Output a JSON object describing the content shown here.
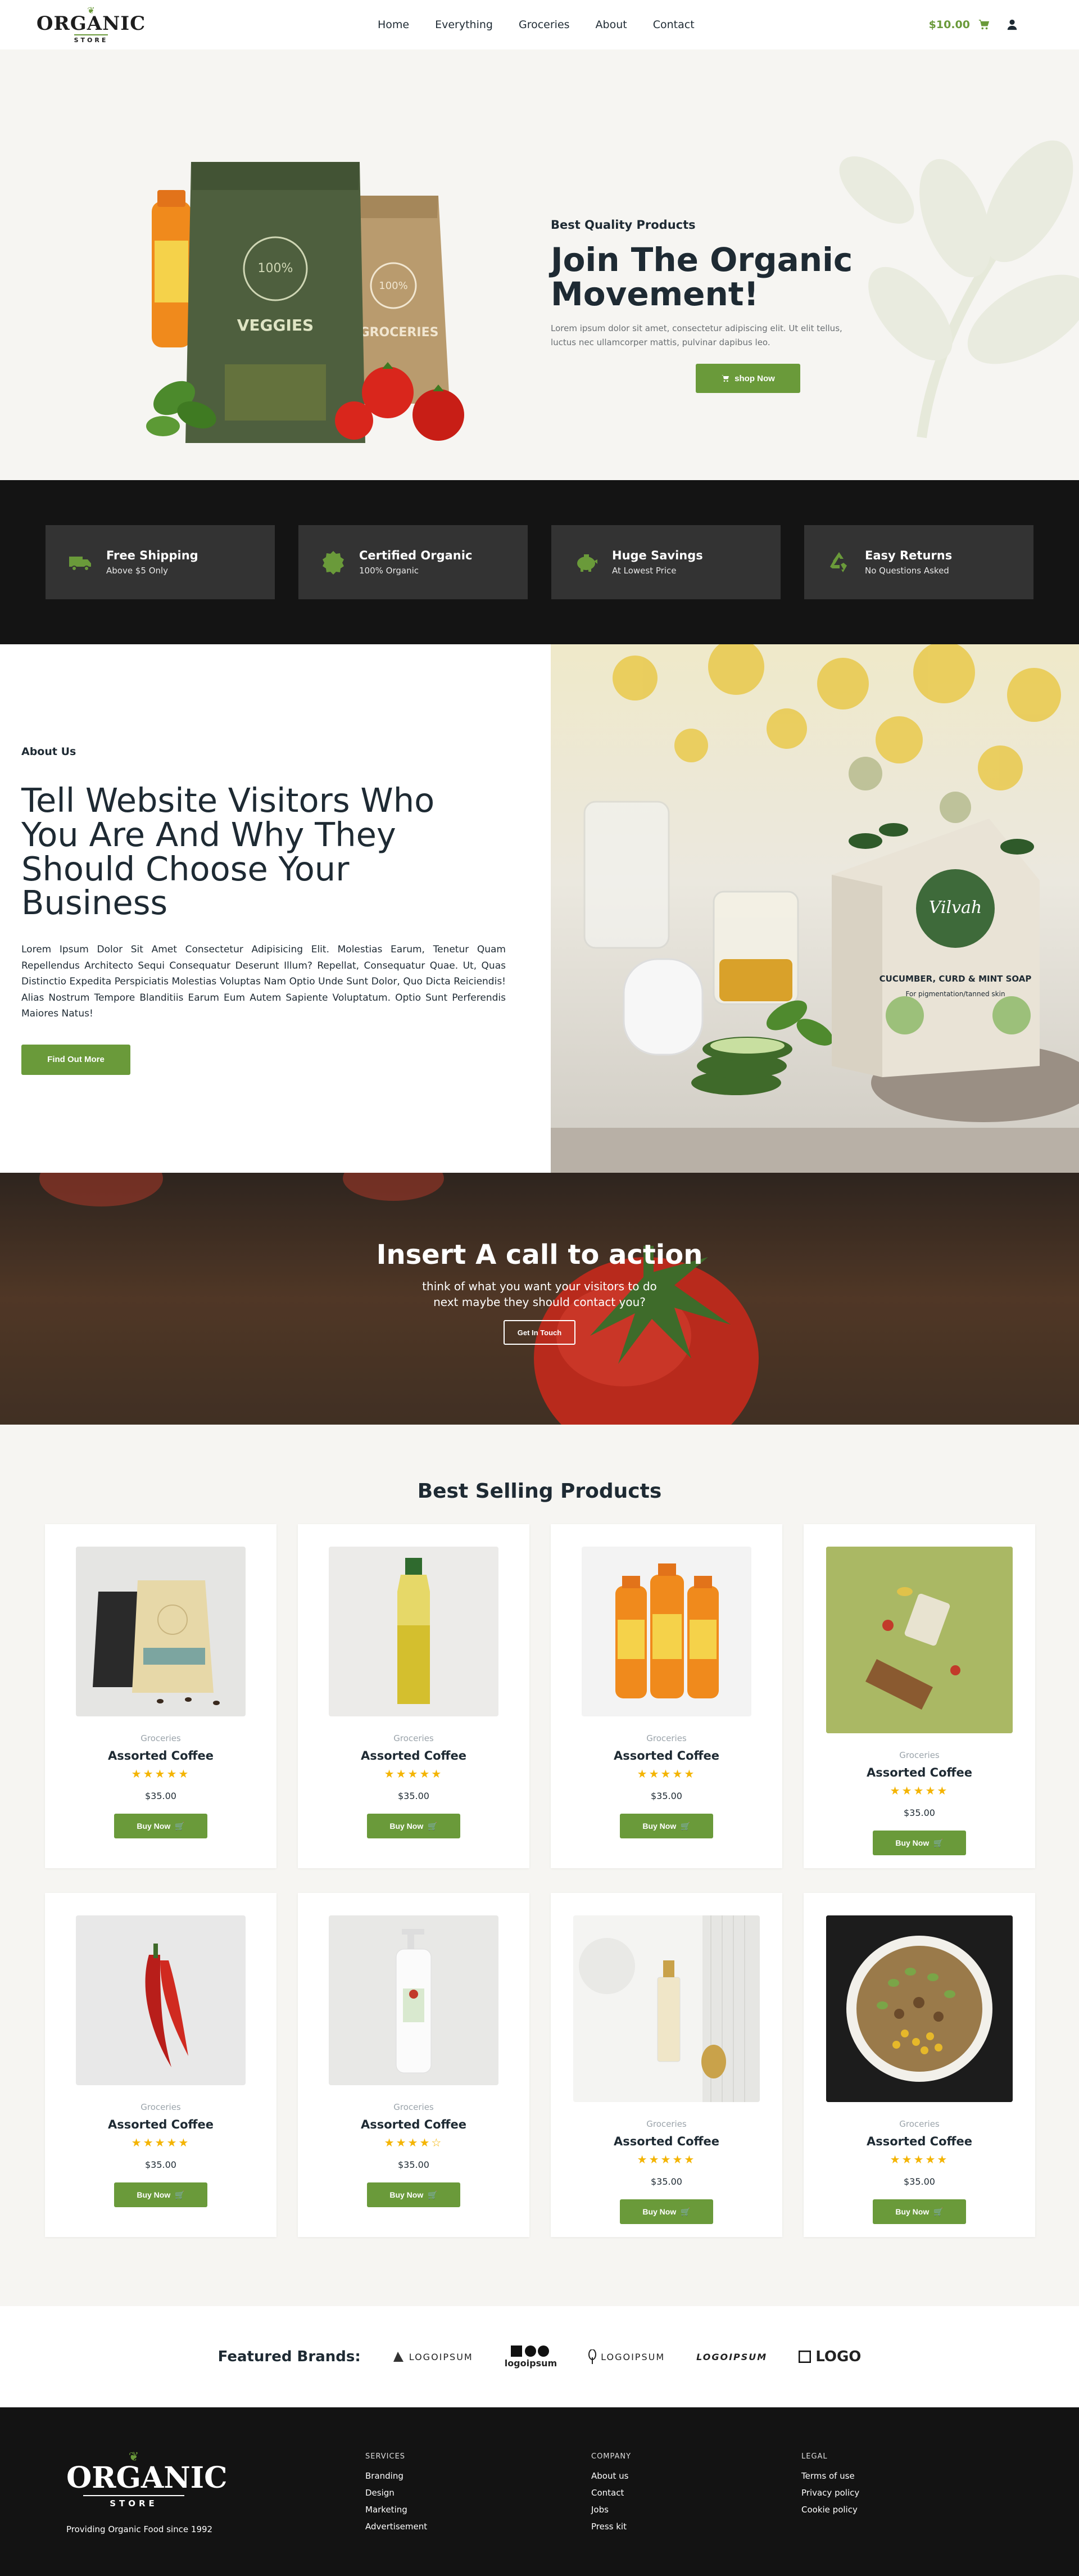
{
  "logo": {
    "top": "ORGANIC",
    "bottom": "STORE"
  },
  "nav": {
    "items": [
      "Home",
      "Everything",
      "Groceries",
      "About",
      "Contact"
    ],
    "cart_total": "$10.00"
  },
  "hero": {
    "subtitle": "Best Quality Products",
    "title": "Join The Organic Movement!",
    "description": "Lorem ipsum dolor sit amet, consectetur adipiscing elit. Ut elit tellus, luctus nec ullamcorper mattis, pulvinar dapibus leo.",
    "button": "shop Now",
    "bag1_label": "VEGGIES",
    "bag2_label": "GROCERIES",
    "badge": "100%"
  },
  "features": [
    {
      "title": "Free Shipping",
      "subtitle": "Above $5 Only",
      "icon": "truck-icon"
    },
    {
      "title": "Certified Organic",
      "subtitle": "100% Organic",
      "icon": "badge-icon"
    },
    {
      "title": "Huge Savings",
      "subtitle": "At Lowest Price",
      "icon": "piggy-bank-icon"
    },
    {
      "title": "Easy Returns",
      "subtitle": "No Questions Asked",
      "icon": "recycle-icon"
    }
  ],
  "about": {
    "tag": "About Us",
    "title": "Tell Website Visitors Who You Are And Why They Should Choose Your Business",
    "text": "Lorem Ipsum Dolor Sit Amet Consectetur Adipisicing Elit. Molestias Earum, Tenetur Quam Repellendus Architecto Sequi Consequatur Deserunt Illum? Repellat, Consequatur Quae. Ut, Quas Distinctio Expedita Perspiciatis Molestias Voluptas Nam Optio Unde Sunt Dolor, Quo Dicta Reiciendis! Alias Nostrum Tempore Blanditiis Earum Eum Autem Sapiente Voluptatum. Optio Sunt Perferendis Maiores Natus!",
    "button": "Find Out More",
    "soap_brand": "Vilvah",
    "soap_name": "CUCUMBER, CURD & MINT SOAP",
    "soap_sub": "For pigmentation/tanned skin"
  },
  "cta": {
    "title": "Insert A call to action",
    "subtitle": "think of what you want your visitors to do next maybe they should contact you?",
    "button": "Get In Touch"
  },
  "products": {
    "title": "Best Selling Products",
    "items": [
      {
        "category": "Groceries",
        "name": "Assorted Coffee",
        "price": "$35.00",
        "button": "Buy Now",
        "stars": "★★★★★",
        "image": "coffee-bags"
      },
      {
        "category": "Groceries",
        "name": "Assorted Coffee",
        "price": "$35.00",
        "button": "Buy Now",
        "stars": "★★★★★",
        "image": "oil-bottle"
      },
      {
        "category": "Groceries",
        "name": "Assorted Coffee",
        "price": "$35.00",
        "button": "Buy Now",
        "stars": "★★★★★",
        "image": "juice-bottles"
      },
      {
        "category": "Groceries",
        "name": "Assorted Coffee",
        "price": "$35.00",
        "button": "Buy Now",
        "stars": "★★★★★",
        "image": "green-food"
      },
      {
        "category": "Groceries",
        "name": "Assorted Coffee",
        "price": "$35.00",
        "button": "Buy Now",
        "stars": "★★★★★",
        "image": "red-peppers"
      },
      {
        "category": "Groceries",
        "name": "Assorted Coffee",
        "price": "$35.00",
        "button": "Buy Now",
        "stars": "★★★★☆",
        "image": "lotion-bottle"
      },
      {
        "category": "Groceries",
        "name": "Assorted Coffee",
        "price": "$35.00",
        "button": "Buy Now",
        "stars": "★★★★★",
        "image": "perfume"
      },
      {
        "category": "Groceries",
        "name": "Assorted Coffee",
        "price": "$35.00",
        "button": "Buy Now",
        "stars": "★★★★★",
        "image": "salad-bowl"
      }
    ]
  },
  "brands": {
    "label": "Featured Brands:",
    "logos": [
      "LOGOIPSUM",
      "logoipsum",
      "LOGOIPSUM",
      "LOGOIPSUM",
      "LOGO"
    ]
  },
  "footer": {
    "tagline": "Providing Organic Food since 1992",
    "columns": [
      {
        "title": "SERVICES",
        "links": [
          "Branding",
          "Design",
          "Marketing",
          "Advertisement"
        ]
      },
      {
        "title": "COMPANY",
        "links": [
          "About us",
          "Contact",
          "Jobs",
          "Press kit"
        ]
      },
      {
        "title": "LEGAL",
        "links": [
          "Terms of use",
          "Privacy policy",
          "Cookie policy"
        ]
      }
    ]
  },
  "colors": {
    "accent": "#6a9a3a",
    "dark": "#141414",
    "light_bg": "#f6f5f2",
    "text": "#1e2a33",
    "star": "#f4b400"
  }
}
